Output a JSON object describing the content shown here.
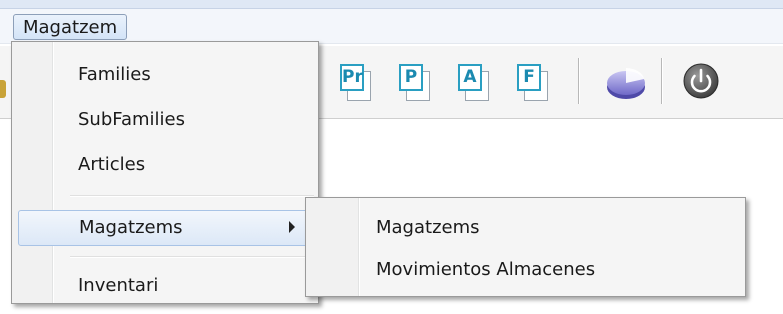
{
  "menubar": {
    "title": "Magatzem"
  },
  "toolbar": {
    "buttons": [
      {
        "icon": "report-pr-icon",
        "letter": "Pr"
      },
      {
        "icon": "report-p-icon",
        "letter": "P"
      },
      {
        "icon": "report-a-icon",
        "letter": "A"
      },
      {
        "icon": "report-f-icon",
        "letter": "F"
      }
    ],
    "chart_icon": "pie-chart-icon",
    "power_icon": "power-icon"
  },
  "main_menu": {
    "items": [
      {
        "label": "Families"
      },
      {
        "label": "SubFamilies"
      },
      {
        "label": "Articles"
      },
      {
        "label": "Magatzems",
        "submenu": true,
        "highlighted": true
      },
      {
        "label": "Inventari"
      }
    ]
  },
  "submenu": {
    "items": [
      {
        "label": "Magatzems"
      },
      {
        "label": "Movimientos Almacenes"
      }
    ]
  },
  "colors": {
    "accent": "#2a9fc2",
    "highlight_border": "#a8c3e6"
  }
}
